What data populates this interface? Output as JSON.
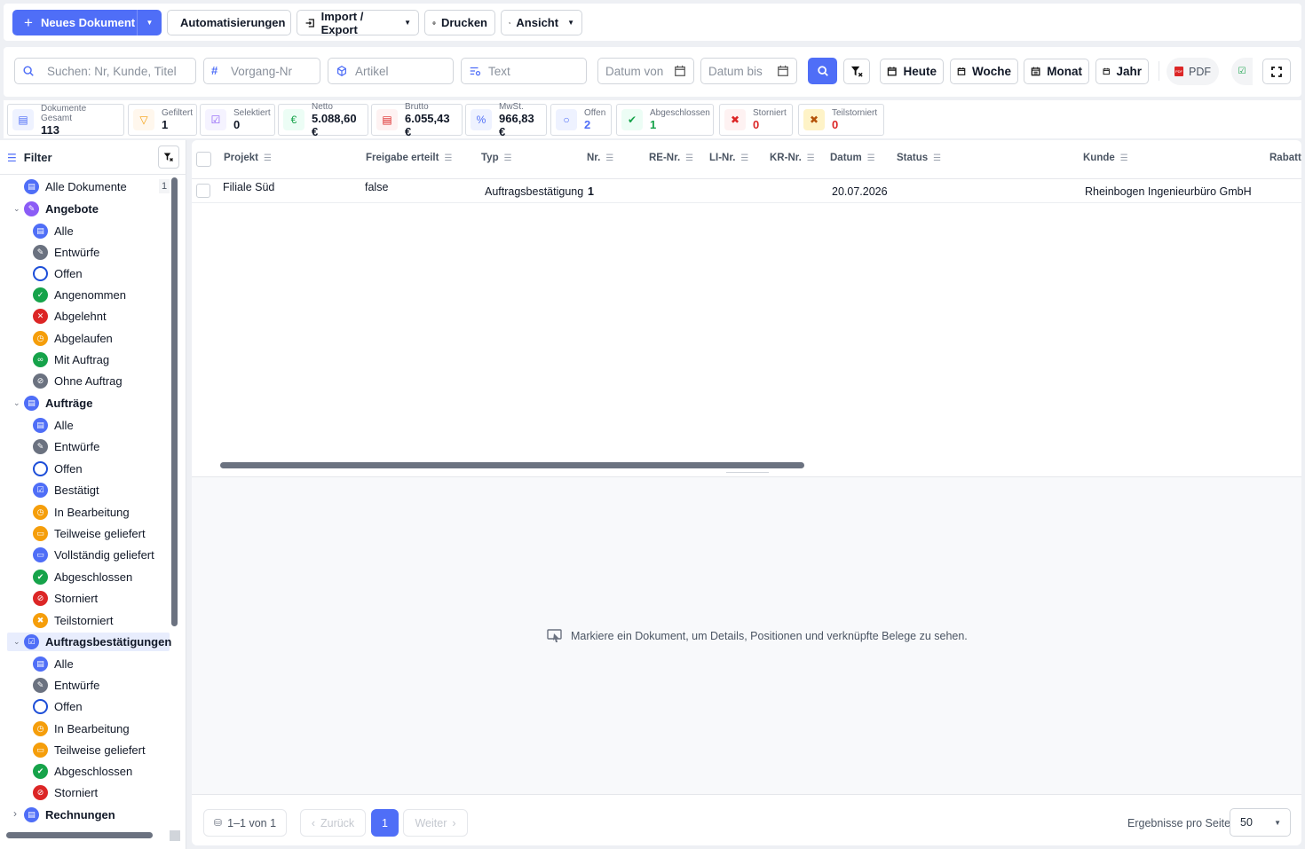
{
  "toolbar": {
    "new_doc": "Neues Dokument",
    "automations": "Automatisierungen",
    "import_export": "Import / Export",
    "print": "Drucken",
    "view": "Ansicht"
  },
  "search": {
    "main_placeholder": "Suchen: Nr, Kunde, Titel",
    "process_placeholder": "Vorgang-Nr",
    "article_placeholder": "Artikel",
    "text_placeholder": "Text",
    "date_from": "Datum von",
    "date_to": "Datum bis"
  },
  "quick": {
    "today": "Heute",
    "week": "Woche",
    "month": "Monat",
    "year": "Jahr",
    "pdf": "PDF"
  },
  "stats": [
    {
      "label": "Dokumente Gesamt",
      "value": "113"
    },
    {
      "label": "Gefiltert",
      "value": "1"
    },
    {
      "label": "Selektiert",
      "value": "0"
    },
    {
      "label": "Netto",
      "value": "5.088,60 €"
    },
    {
      "label": "Brutto",
      "value": "6.055,43 €"
    },
    {
      "label": "MwSt.",
      "value": "966,83 €"
    },
    {
      "label": "Offen",
      "value": "2"
    },
    {
      "label": "Abgeschlossen",
      "value": "1"
    },
    {
      "label": "Storniert",
      "value": "0"
    },
    {
      "label": "Teilstorniert",
      "value": "0"
    }
  ],
  "sidebar": {
    "title": "Filter",
    "all_docs": "Alle Dokumente",
    "all_docs_count": "1",
    "groups": [
      {
        "label": "Angebote",
        "items": [
          "Alle",
          "Entwürfe",
          "Offen",
          "Angenommen",
          "Abgelehnt",
          "Abgelaufen",
          "Mit Auftrag",
          "Ohne Auftrag"
        ]
      },
      {
        "label": "Aufträge",
        "items": [
          "Alle",
          "Entwürfe",
          "Offen",
          "Bestätigt",
          "In Bearbeitung",
          "Teilweise geliefert",
          "Vollständig geliefert",
          "Abgeschlossen",
          "Storniert",
          "Teilstorniert"
        ]
      },
      {
        "label": "Auftragsbestätigungen",
        "items": [
          "Alle",
          "Entwürfe",
          "Offen",
          "In Bearbeitung",
          "Teilweise geliefert",
          "Abgeschlossen",
          "Storniert"
        ]
      },
      {
        "label": "Rechnungen",
        "items": []
      }
    ]
  },
  "table": {
    "columns": [
      "Projekt",
      "Freigabe erteilt",
      "Typ",
      "Nr.",
      "RE-Nr.",
      "LI-Nr.",
      "KR-Nr.",
      "Datum",
      "Status",
      "Kunde",
      "Rabatt"
    ],
    "rows": [
      {
        "projekt": "Filiale Süd",
        "freigabe": "false",
        "typ": "Auftragsbestätigung",
        "nr": "1",
        "datum": "20.07.2026",
        "kunde": "Rheinbogen Ingenieurbüro GmbH"
      }
    ]
  },
  "detail": {
    "hint": "Markiere ein Dokument, um Details, Positionen und verknüpfte Belege zu sehen."
  },
  "pagination": {
    "range": "1–1 von 1",
    "prev": "Zurück",
    "page": "1",
    "next": "Weiter",
    "per_page_label": "Ergebnisse pro Seite",
    "per_page": "50"
  },
  "colors": {
    "accent": "#4f6ef7",
    "green": "#16a34a",
    "red": "#dc2626",
    "orange": "#f59e0b",
    "purple": "#8b5cf6"
  }
}
